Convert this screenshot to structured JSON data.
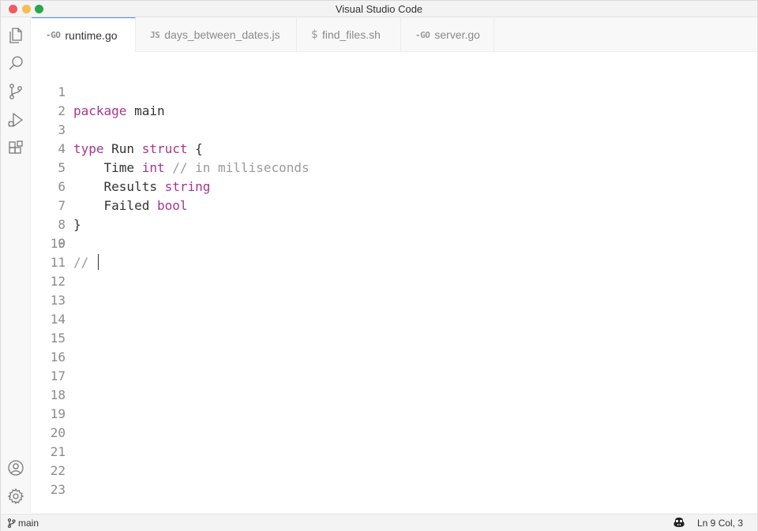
{
  "window": {
    "title": "Visual Studio Code"
  },
  "tabs": [
    {
      "label": "runtime.go",
      "icon": "go-icon",
      "glyph": "-GO",
      "active": true
    },
    {
      "label": "days_between_dates.js",
      "icon": "javascript-icon",
      "glyph": "JS",
      "active": false
    },
    {
      "label": "find_files.sh",
      "icon": "shell-icon",
      "glyph": "$",
      "active": false
    },
    {
      "label": "server.go",
      "icon": "go-icon",
      "glyph": "-GO",
      "active": false
    }
  ],
  "editor": {
    "line_numbers": [
      "1",
      "2",
      "3",
      "4",
      "5",
      "6",
      "7",
      "8",
      "9",
      "10",
      "11",
      "12",
      "13",
      "14",
      "15",
      "16",
      "17",
      "18",
      "19",
      "20",
      "21",
      "22",
      "23"
    ],
    "code": {
      "l1_kw": "package",
      "l1_rest": " main",
      "l3_kw1": "type",
      "l3_mid": " Run ",
      "l3_kw2": "struct",
      "l3_rest": " {",
      "l4_ind": "    Time ",
      "l4_kw": "int",
      "l4_cm": " // in milliseconds",
      "l5_ind": "    Results ",
      "l5_kw": "string",
      "l6_ind": "    Failed ",
      "l6_kw": "bool",
      "l7": "}",
      "l9_cm": "// "
    }
  },
  "status": {
    "branch": "main",
    "position": "Ln 9 Col, 3"
  },
  "activity_icons": [
    "explorer-icon",
    "search-icon",
    "source-control-icon",
    "run-debug-icon",
    "extensions-icon",
    "account-icon",
    "settings-gear-icon"
  ]
}
